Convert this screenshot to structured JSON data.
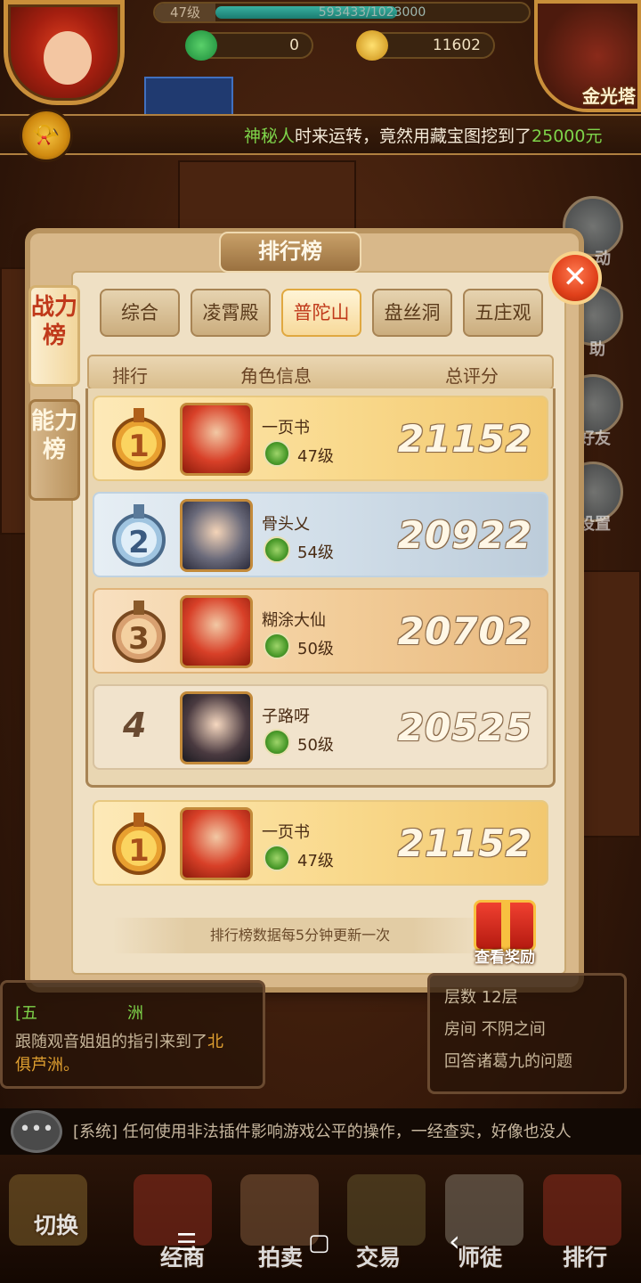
{
  "hud": {
    "level": "47级",
    "exp_text": "593433/1023000",
    "exp_fraction": 0.58,
    "currency_green": "0",
    "currency_gold": "11602",
    "tower_label": "金光塔"
  },
  "broadcast": {
    "highlight_name": "神秘人",
    "message": "时来运转，竟然用藏宝图挖到了",
    "highlight_amount": "25000元"
  },
  "panel": {
    "title": "排行榜",
    "side_tabs": [
      {
        "label": "战力榜",
        "active": true
      },
      {
        "label": "能力榜",
        "active": false
      }
    ],
    "tabs": [
      {
        "label": "综合",
        "active": false
      },
      {
        "label": "凌霄殿",
        "active": false
      },
      {
        "label": "普陀山",
        "active": true
      },
      {
        "label": "盘丝洞",
        "active": false
      },
      {
        "label": "五庄观",
        "active": false
      }
    ],
    "columns": {
      "rank": "排行",
      "role": "角色信息",
      "score": "总评分"
    },
    "rows": [
      {
        "rank": "1",
        "name": "一页书",
        "level": "47级",
        "score": "21152",
        "style": "gold"
      },
      {
        "rank": "2",
        "name": "骨头乂",
        "level": "54级",
        "score": "20922",
        "style": "silver"
      },
      {
        "rank": "3",
        "name": "糊涂大仙",
        "level": "50级",
        "score": "20702",
        "style": "bronze"
      },
      {
        "rank": "4",
        "name": "子路呀",
        "level": "50级",
        "score": "20525",
        "style": "plain"
      }
    ],
    "my_row": {
      "rank": "1",
      "name": "一页书",
      "level": "47级",
      "score": "21152"
    },
    "update_note": "排行榜数据每5分钟更新一次",
    "reward_label": "查看奖励"
  },
  "quests": {
    "left_title": "[五",
    "left_location": "洲",
    "left_line1": "跟随观音姐姐的指引来到了",
    "left_highlight": "北",
    "left_line2": "俱芦洲。",
    "right_line1": "层数 12层",
    "right_line2": "房间 不阴之间",
    "right_line3": "回答诸葛九的问题"
  },
  "chat": {
    "message": "[系统] 任何使用非法插件影响游戏公平的操作，一经查实，好像也没人"
  },
  "bottom_nav": {
    "switch": "切换",
    "business": "经商",
    "auction": "拍卖",
    "trade": "交易",
    "mentor": "师徒",
    "ranking": "排行"
  },
  "side_labels": {
    "label1": "动",
    "label2": "助",
    "label3": "好友",
    "label4": "设置"
  },
  "system_nav": {
    "menu": "☰",
    "home": "▢",
    "back": "‹"
  }
}
